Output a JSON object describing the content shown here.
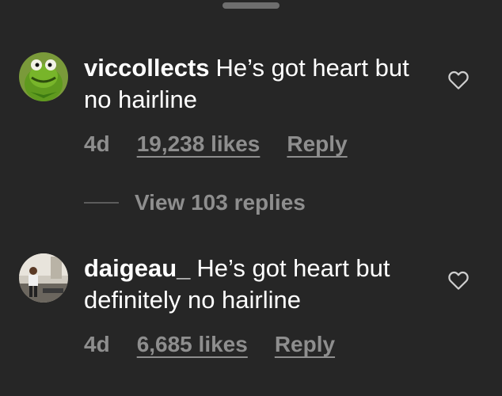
{
  "comments": [
    {
      "username": "viccollects",
      "text": "He’s got heart but no hairline",
      "time": "4d",
      "likes": "19,238 likes",
      "reply": "Reply",
      "avatar_icon": "kermit-frog-avatar",
      "heart_icon": "heart-outline-icon"
    },
    {
      "username": "daigeau_",
      "text": "He’s got heart but definitely no hairline",
      "time": "4d",
      "likes": "6,685 likes",
      "reply": "Reply",
      "avatar_icon": "person-photo-avatar",
      "heart_icon": "heart-outline-icon"
    }
  ],
  "view_replies": "View 103 replies",
  "colors": {
    "background": "#262626",
    "primary_text": "#ffffff",
    "secondary_text": "#8e8e8e"
  }
}
